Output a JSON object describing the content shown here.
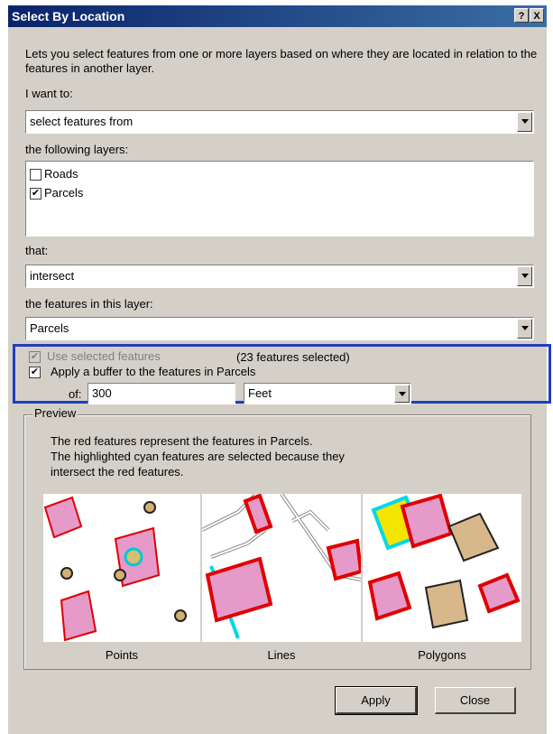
{
  "title": "Select By Location",
  "title_buttons": [
    "?",
    "X"
  ],
  "description": "Lets you select features from one or more layers based on where they are located in relation to the features in another layer.",
  "i_want_to": {
    "label": "I want to:",
    "value": "select features from"
  },
  "layers": {
    "label": "the following layers:",
    "items": [
      {
        "name": "Roads",
        "checked": false
      },
      {
        "name": "Parcels",
        "checked": true
      }
    ]
  },
  "that": {
    "label": "that:",
    "value": "intersect"
  },
  "features_layer": {
    "label": "the features in this layer:",
    "value": "Parcels"
  },
  "use_selected": {
    "label": "Use selected features",
    "count": "(23 features selected)"
  },
  "buffer": {
    "label": "Apply a buffer to the features in  Parcels",
    "of": "of:",
    "distance": "300",
    "unit": "Feet"
  },
  "preview": {
    "legend": "Preview",
    "line1": "The red features represent the features in Parcels.",
    "line2": "The highlighted cyan features are selected because they",
    "line3": "intersect the red features.",
    "captions": [
      "Points",
      "Lines",
      "Polygons"
    ]
  },
  "buttons": {
    "apply": "Apply",
    "close": "Close"
  }
}
